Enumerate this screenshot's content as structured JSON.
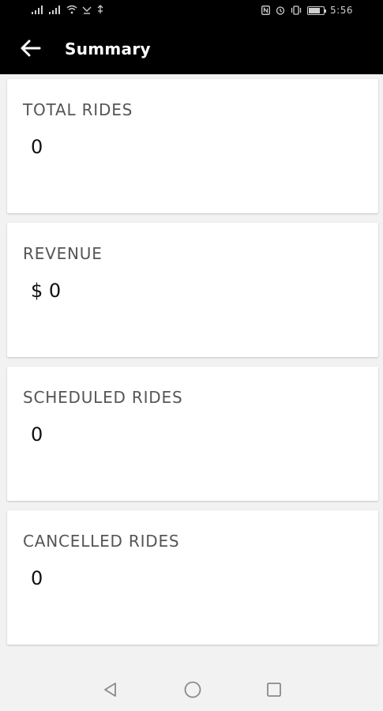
{
  "status_bar": {
    "left_icons": [
      "signal-icon",
      "signal-icon",
      "wifi-icon",
      "usb-icon",
      "location-icon"
    ],
    "right_icons": [
      "nfc-icon",
      "alarm-icon",
      "vibrate-icon",
      "battery-icon"
    ],
    "battery": "89",
    "time": "5:56"
  },
  "app_bar": {
    "back_icon": "arrow-left-icon",
    "title": "Summary"
  },
  "cards": [
    {
      "label": "TOTAL RIDES",
      "value": "0"
    },
    {
      "label": "REVENUE",
      "value": "$ 0"
    },
    {
      "label": "SCHEDULED RIDES",
      "value": "0"
    },
    {
      "label": "CANCELLED RIDES",
      "value": "0"
    }
  ],
  "nav_bar": {
    "buttons": [
      "triangle-back-icon",
      "circle-home-icon",
      "square-recents-icon"
    ]
  },
  "colors": {
    "app_bar_bg": "#000000",
    "page_bg": "#f2f2f2",
    "card_bg": "#ffffff",
    "label_text": "#555555",
    "value_text": "#111111"
  }
}
